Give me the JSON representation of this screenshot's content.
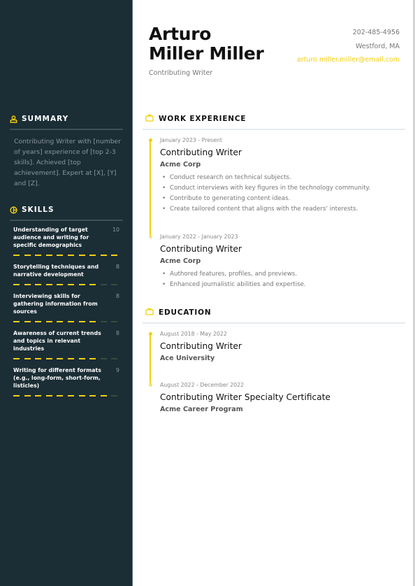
{
  "header": {
    "first_name": "Arturo",
    "last_name": "Miller Miller",
    "role": "Contributing Writer",
    "phone": "202-485-4956",
    "location": "Westford, MA",
    "email": "arturo miller.miller@email.com"
  },
  "colors": {
    "sidebar": "#1b2d35",
    "accent": "#f3cf0f"
  },
  "sidebar": {
    "summary": {
      "title": "SUMMARY",
      "icon": "person-icon",
      "text": "Contributing Writer with [number of years] experience of [top 2-3 skills]. Achieved [top achievement]. Expert at [X], [Y] and [Z]."
    },
    "skills": {
      "title": "SKILLS",
      "icon": "chart-icon",
      "max": 10,
      "items": [
        {
          "name": "Understanding of target audience and writing for specific demographics",
          "score": "10",
          "level": 10
        },
        {
          "name": "Storytelling techniques and narrative development",
          "score": "8",
          "level": 8
        },
        {
          "name": "Interviewing skills for gathering information from sources",
          "score": "8",
          "level": 8
        },
        {
          "name": "Awareness of current trends and topics in relevant industries",
          "score": "8",
          "level": 8
        },
        {
          "name": "Writing for different formats (e.g., long-form, short-form, listicles)",
          "score": "9",
          "level": 9
        }
      ]
    }
  },
  "work": {
    "title": "WORK EXPERIENCE",
    "icon": "briefcase-icon",
    "entries": [
      {
        "date": "January 2023 - Present",
        "title": "Contributing Writer",
        "org": "Acme Corp",
        "bullets": [
          "Conduct research on technical subjects.",
          "Conduct interviews with key figures in the technology community.",
          "Contribute to generating content ideas.",
          "Create tailored content that aligns with the readers' interests."
        ]
      },
      {
        "date": "January 2022 - January 2023",
        "title": "Contributing Writer",
        "org": "Acme Corp",
        "bullets": [
          "Authored features, profiles, and previews.",
          "Enhanced journalistic abilities and expertise."
        ]
      }
    ]
  },
  "education": {
    "title": "EDUCATION",
    "icon": "briefcase-icon",
    "entries": [
      {
        "date": "August 2018 - May 2022",
        "title": "Contributing Writer",
        "org": "Ace University"
      },
      {
        "date": "August 2022 - December 2022",
        "title": "Contributing Writer Specialty Certificate",
        "org": "Acme Career Program"
      }
    ]
  }
}
